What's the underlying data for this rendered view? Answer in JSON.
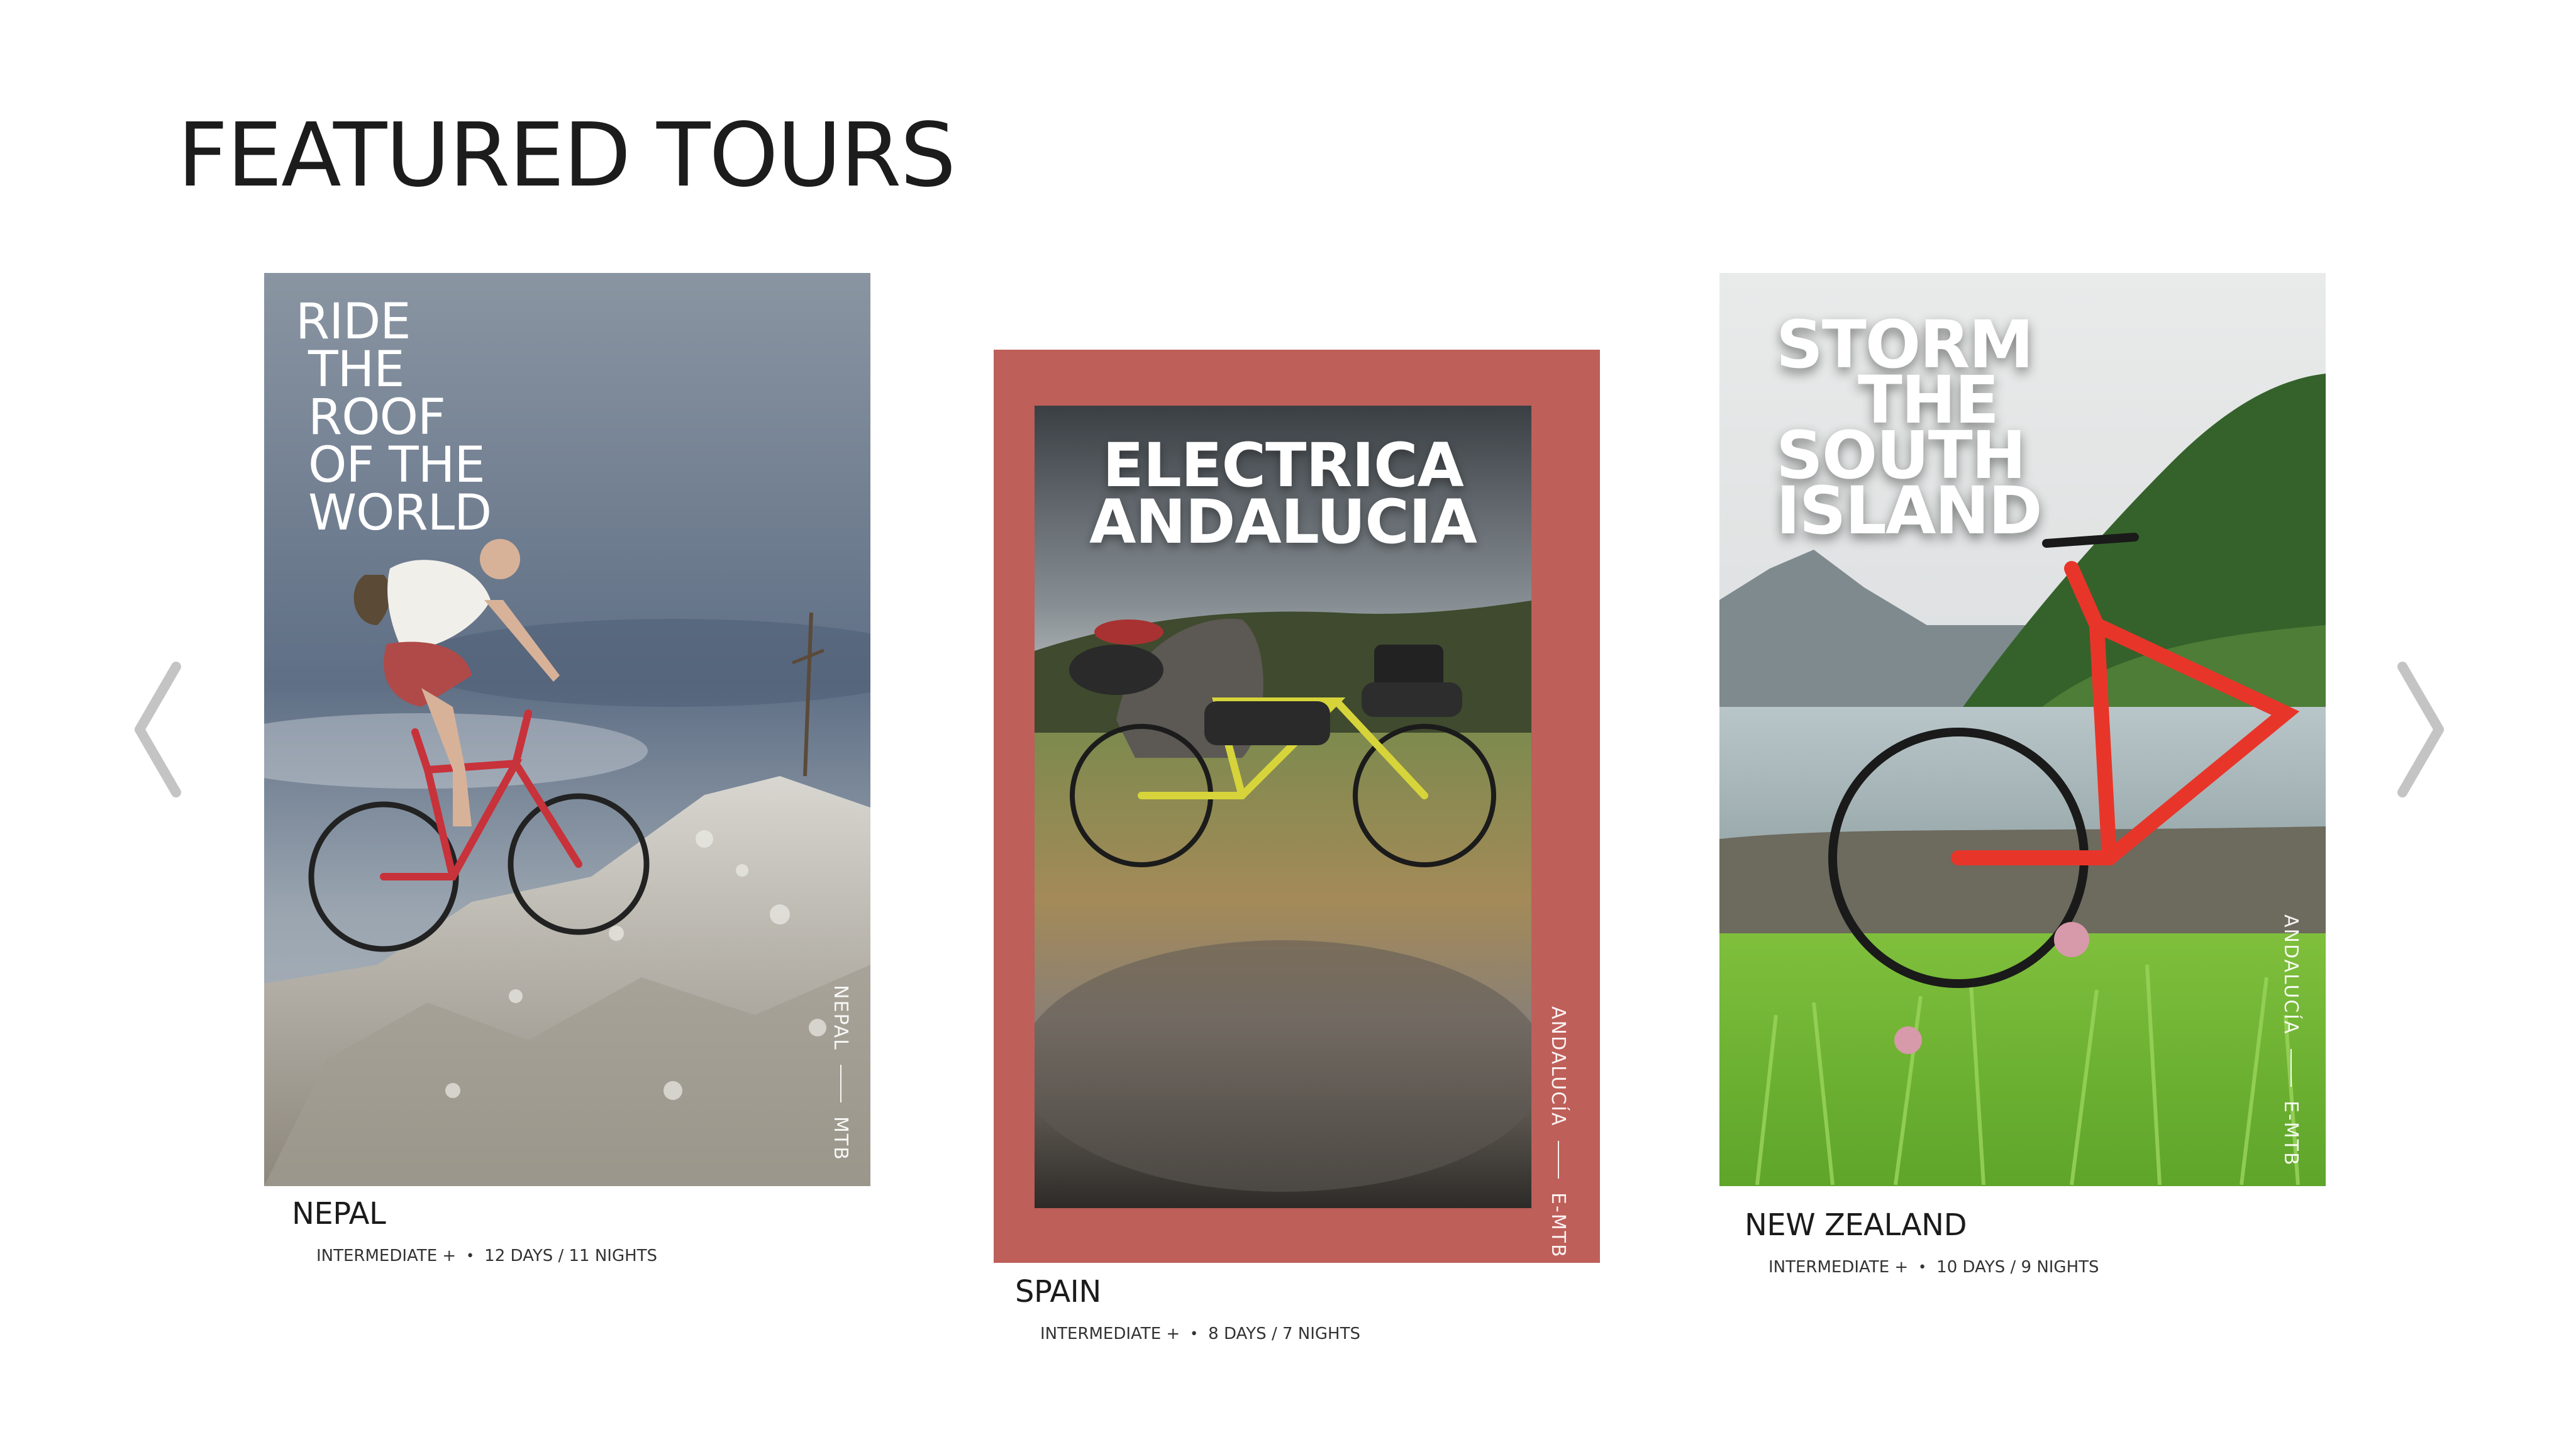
{
  "section": {
    "heading": "FEATURED TOURS"
  },
  "nav": {
    "prev_icon": "chevron-left-icon",
    "next_icon": "chevron-right-icon",
    "arrow_color": "#c4c4c4"
  },
  "tours": [
    {
      "poster_headline": [
        "RIDE",
        "THE",
        "ROOF",
        "OF THE",
        "WORLD"
      ],
      "poster_tag": {
        "place": "NEPAL",
        "type": "MTB"
      },
      "title": "NEPAL",
      "level": "INTERMEDIATE +",
      "duration": "12 DAYS / 11 NIGHTS"
    },
    {
      "poster_headline": [
        "ELECTRICA",
        "ANDALUCIA"
      ],
      "poster_tag": {
        "place": "ANDALUCÍA",
        "type": "E-MTB"
      },
      "frame_color": "#be5f59",
      "title": "SPAIN",
      "level": "INTERMEDIATE +",
      "duration": "8 DAYS / 7 NIGHTS"
    },
    {
      "poster_headline": [
        "STORM",
        "THE",
        "SOUTH",
        "ISLAND"
      ],
      "poster_tag": {
        "place": "ANDALUCÍA",
        "type": "E-MTB"
      },
      "title": "NEW ZEALAND",
      "level": "INTERMEDIATE +",
      "duration": "10 DAYS / 9 NIGHTS"
    }
  ]
}
